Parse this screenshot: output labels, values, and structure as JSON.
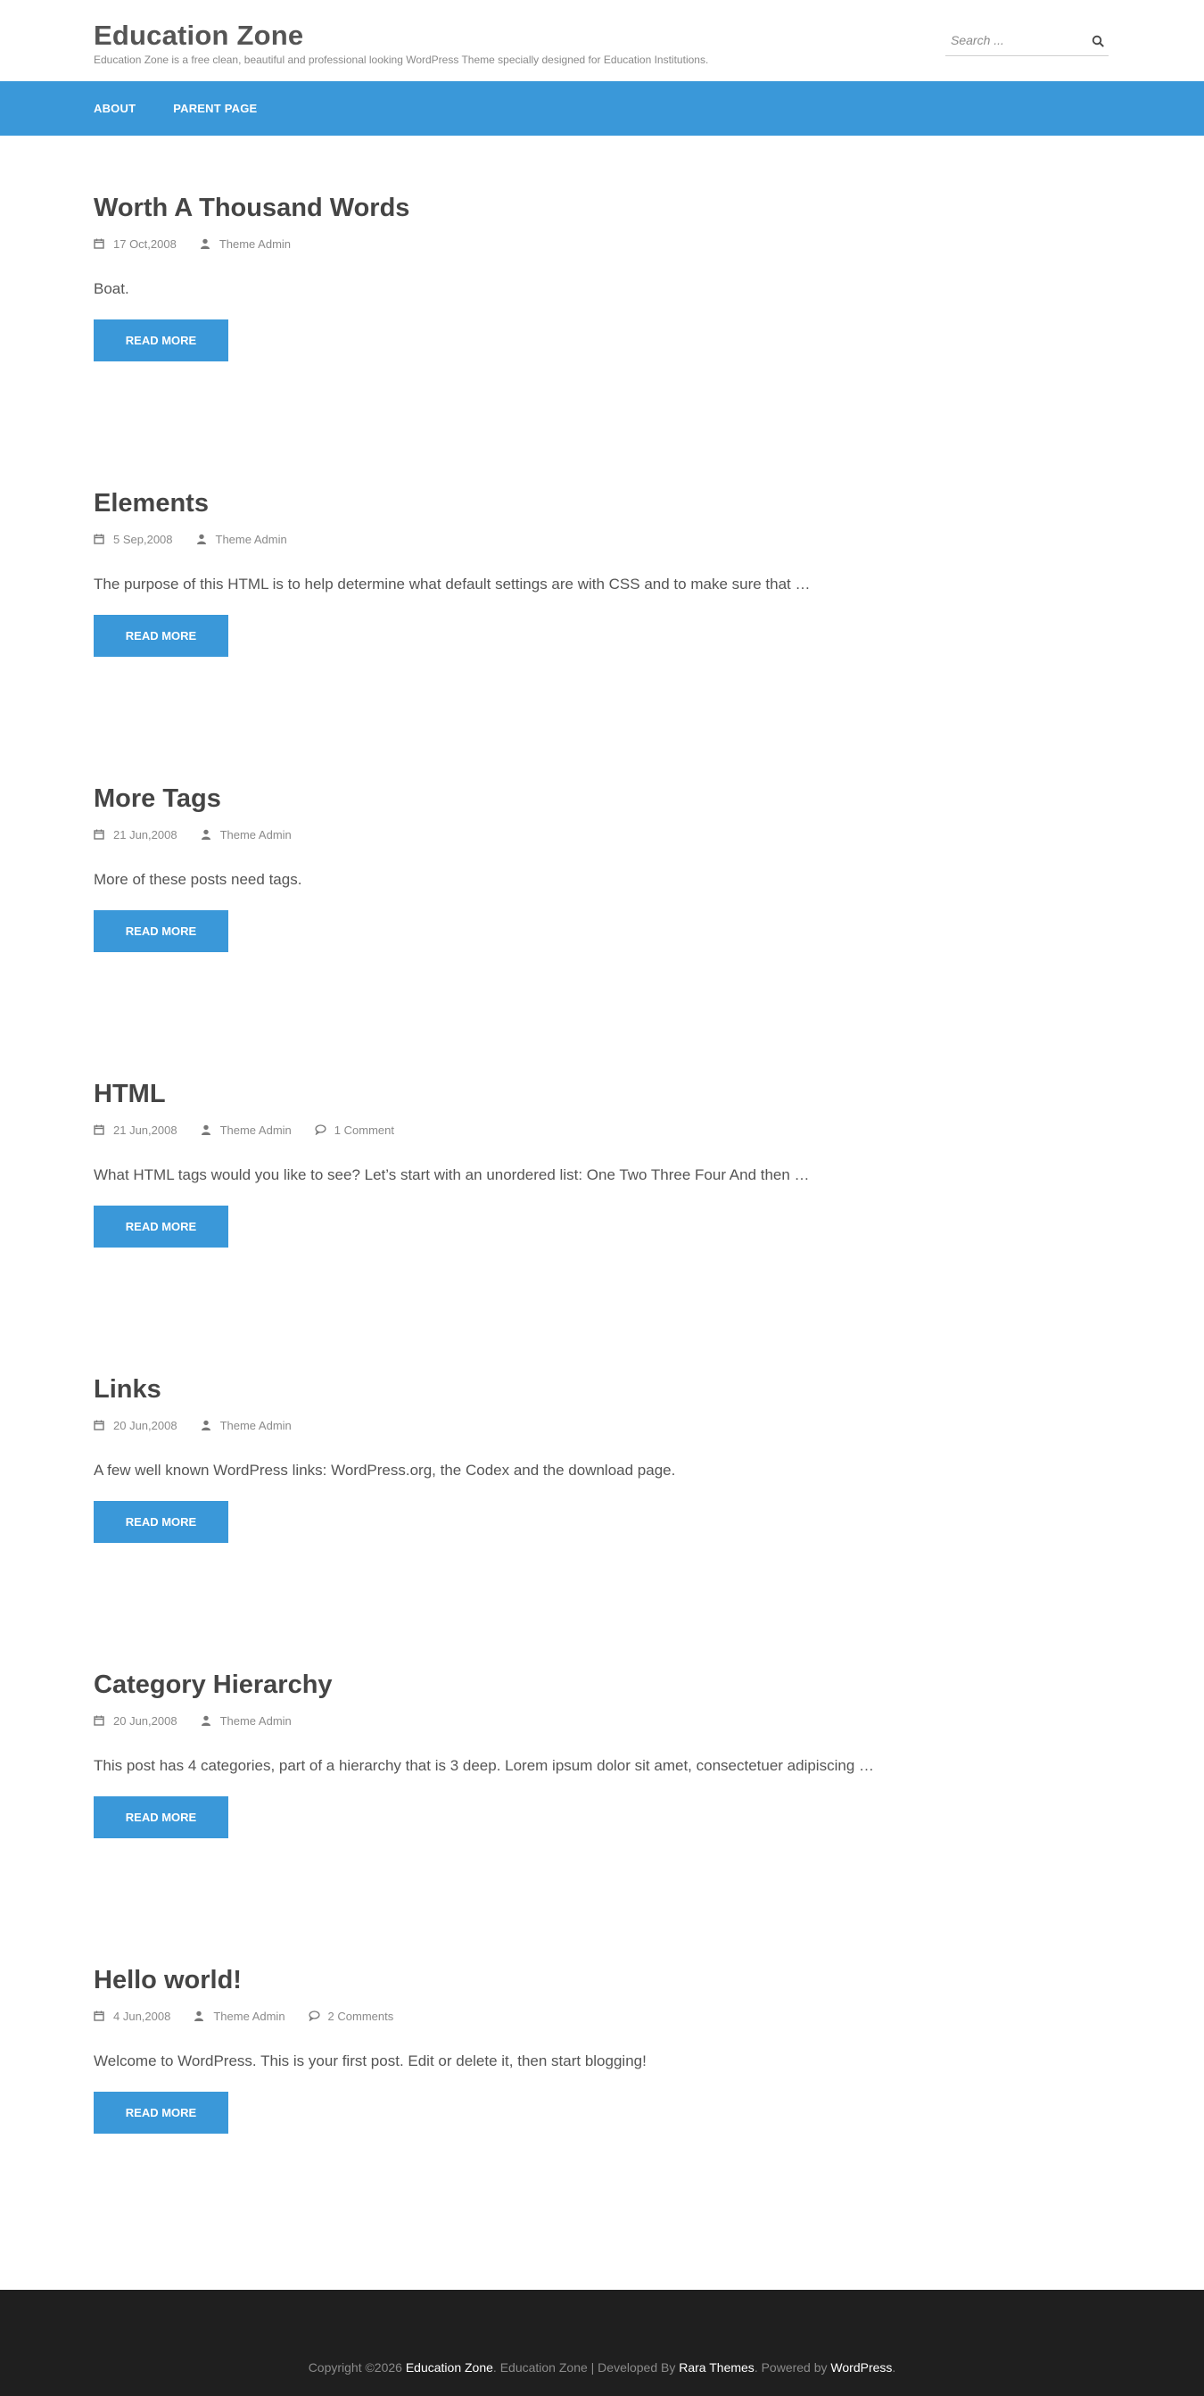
{
  "site": {
    "title": "Education Zone",
    "description": "Education Zone is a free clean, beautiful and professional looking WordPress Theme specially designed for Education Institutions."
  },
  "search": {
    "placeholder": "Search ..."
  },
  "nav": {
    "items": [
      {
        "label": "About"
      },
      {
        "label": "Parent Page"
      }
    ]
  },
  "posts": [
    {
      "title": "Worth A Thousand Words",
      "date": "17 Oct,2008",
      "author": "Theme Admin",
      "comments": "",
      "excerpt": "Boat.",
      "read_more": "Read More"
    },
    {
      "title": "Elements",
      "date": "5 Sep,2008",
      "author": "Theme Admin",
      "comments": "",
      "excerpt": "The purpose of this HTML is to help determine what default settings are with CSS and to make sure that …",
      "read_more": "Read More"
    },
    {
      "title": "More Tags",
      "date": "21 Jun,2008",
      "author": "Theme Admin",
      "comments": "",
      "excerpt": "More of these posts need tags.",
      "read_more": "Read More"
    },
    {
      "title": "HTML",
      "date": "21 Jun,2008",
      "author": "Theme Admin",
      "comments": "1 Comment",
      "excerpt": "What HTML tags would you like to see? Let’s start with an unordered list: One Two Three Four And then …",
      "read_more": "Read More"
    },
    {
      "title": "Links",
      "date": "20 Jun,2008",
      "author": "Theme Admin",
      "comments": "",
      "excerpt": "A few well known WordPress links: WordPress.org, the Codex and the download page.",
      "read_more": "Read More"
    },
    {
      "title": "Category Hierarchy",
      "date": "20 Jun,2008",
      "author": "Theme Admin",
      "comments": "",
      "excerpt": "This post has 4 categories, part of a hierarchy that is 3 deep. Lorem ipsum dolor sit amet, consectetuer adipiscing …",
      "read_more": "Read More"
    },
    {
      "title": "Hello world!",
      "date": "4 Jun,2008",
      "author": "Theme Admin",
      "comments": "2 Comments",
      "excerpt": "Welcome to WordPress. This is your first post. Edit or delete it, then start blogging!",
      "read_more": "Read More"
    }
  ],
  "footer": {
    "copyright_prefix": "Copyright ©2026 ",
    "site_link": "Education Zone",
    "middle_text": ". Education Zone | Developed By ",
    "developer_link": "Rara Themes",
    "powered_text": ". Powered by ",
    "powered_link": "WordPress",
    "end_text": "."
  },
  "icons": {
    "date": "calendar-icon",
    "author": "user-icon",
    "comments": "comment-icon",
    "search": "search-icon"
  },
  "colors": {
    "accent": "#3a98d9",
    "footer_bg": "#1f1f1f",
    "title": "#454545",
    "meta": "#8a8a8a"
  }
}
